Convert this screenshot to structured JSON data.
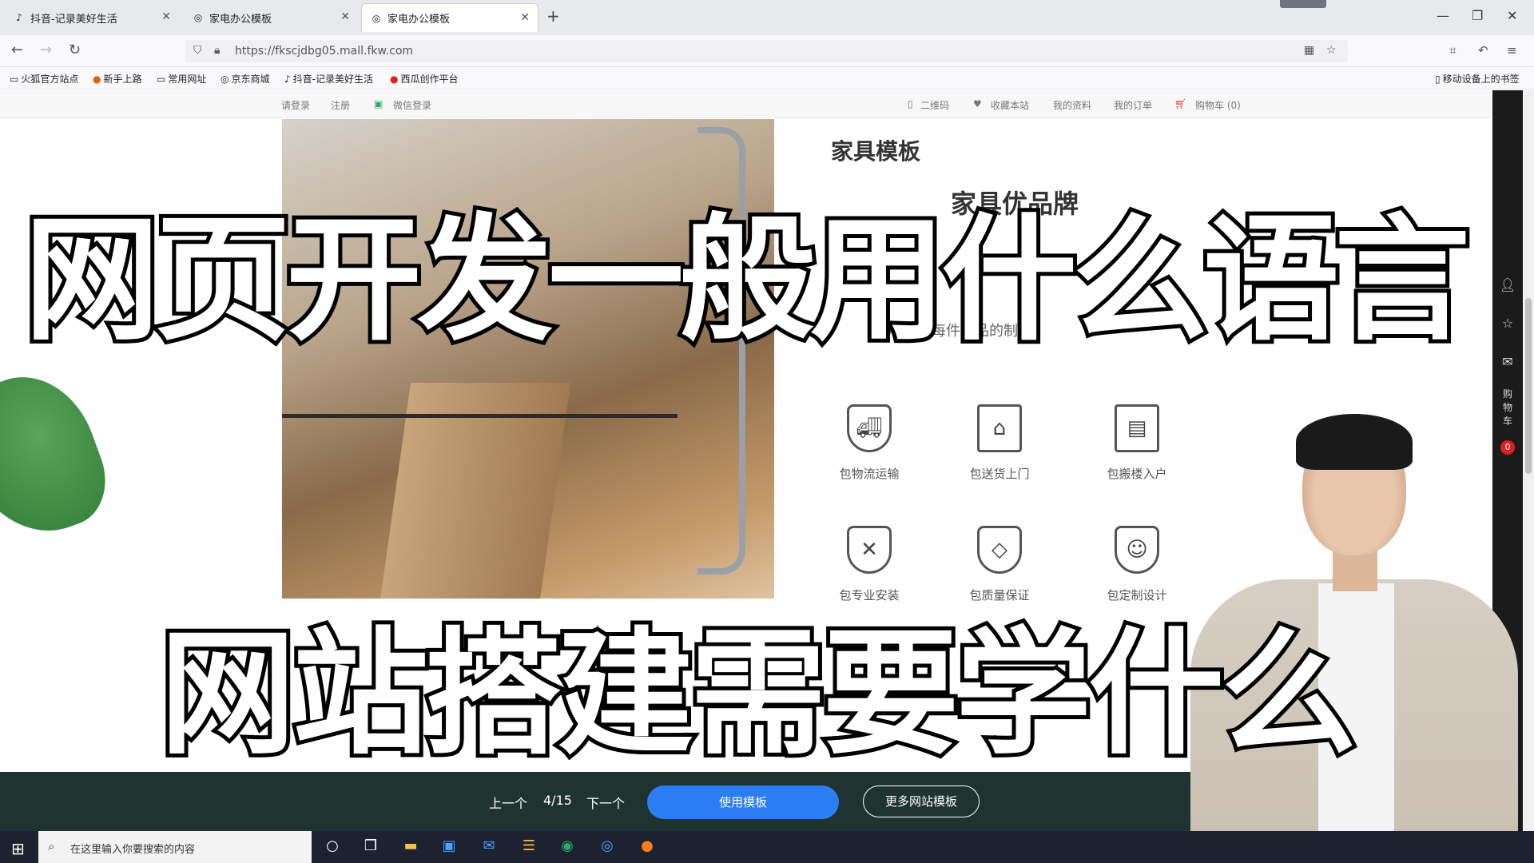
{
  "browser": {
    "tabs": [
      {
        "title": "抖音-记录美好生活",
        "active": false
      },
      {
        "title": "家电办公模板",
        "active": false
      },
      {
        "title": "家电办公模板",
        "active": true
      }
    ],
    "url": "https://fkscjdbg05.mall.fkw.com",
    "bookmarks": [
      "火狐官方站点",
      "新手上路",
      "常用网址",
      "京东商城",
      "抖音-记录美好生活",
      "西瓜创作平台"
    ],
    "mobile_bookmarks": "移动设备上的书签"
  },
  "site_topbar": {
    "login": "请登录",
    "register": "注册",
    "wechat_login": "微信登录",
    "qrcode": "二维码",
    "favorite": "收藏本站",
    "my_profile": "我的资料",
    "my_orders": "我的订单",
    "cart": "购物车 (0)"
  },
  "content": {
    "section_title": "家具模板",
    "brand_text": "家具优品牌",
    "subtitle": "用心对待每件产品的制作",
    "services_row1": [
      "包物流运输",
      "包送货上门",
      "包搬楼入户"
    ],
    "services_row2": [
      "包专业安装",
      "包质量保证",
      "包定制设计"
    ]
  },
  "overlay": {
    "caption_top": "网页开发一般用什么语言",
    "caption_bottom": "网站搭建需要学什么"
  },
  "sidebar": {
    "cart_label": "购物车",
    "cart_count": "0"
  },
  "template_bar": {
    "prev": "上一个",
    "page": "4/15",
    "next": "下一个",
    "use_template": "使用模板",
    "more_templates": "更多网站模板"
  },
  "taskbar": {
    "search_placeholder": "在这里输入你要搜索的内容"
  }
}
